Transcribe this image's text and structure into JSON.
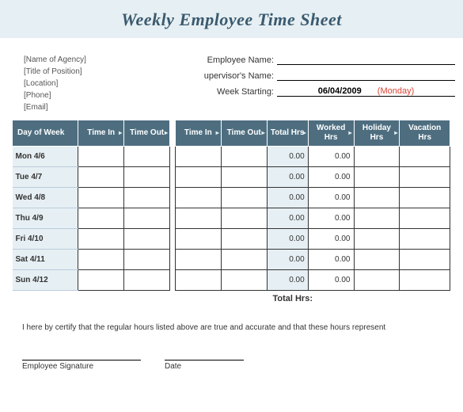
{
  "title": "Weekly Employee Time Sheet",
  "agency": {
    "name": "[Name of Agency]",
    "title_of_position": "[Title of Position]",
    "location": "[Location]",
    "phone": "[Phone]",
    "email": "[Email]"
  },
  "fields": {
    "employee_name_label": "Employee Name:",
    "employee_name_value": "",
    "supervisor_name_label": "upervisor's Name:",
    "supervisor_name_value": "",
    "week_starting_label": "Week Starting:",
    "week_starting_value": "06/04/2009",
    "week_starting_day": "(Monday)"
  },
  "headers": {
    "day": "Day of Week",
    "time_in": "Time In",
    "time_out": "Time Out",
    "total_hrs": "Total Hrs",
    "worked_hrs": "Worked Hrs",
    "holiday_hrs": "Holiday Hrs",
    "vacation_hrs": "Vacation Hrs"
  },
  "rows": [
    {
      "day": "Mon 4/6",
      "in1": "",
      "out1": "",
      "in2": "",
      "out2": "",
      "total": "0.00",
      "worked": "0.00",
      "holiday": "",
      "vacation": ""
    },
    {
      "day": "Tue 4/7",
      "in1": "",
      "out1": "",
      "in2": "",
      "out2": "",
      "total": "0.00",
      "worked": "0.00",
      "holiday": "",
      "vacation": ""
    },
    {
      "day": "Wed 4/8",
      "in1": "",
      "out1": "",
      "in2": "",
      "out2": "",
      "total": "0.00",
      "worked": "0.00",
      "holiday": "",
      "vacation": ""
    },
    {
      "day": "Thu 4/9",
      "in1": "",
      "out1": "",
      "in2": "",
      "out2": "",
      "total": "0.00",
      "worked": "0.00",
      "holiday": "",
      "vacation": ""
    },
    {
      "day": "Fri 4/10",
      "in1": "",
      "out1": "",
      "in2": "",
      "out2": "",
      "total": "0.00",
      "worked": "0.00",
      "holiday": "",
      "vacation": ""
    },
    {
      "day": "Sat 4/11",
      "in1": "",
      "out1": "",
      "in2": "",
      "out2": "",
      "total": "0.00",
      "worked": "0.00",
      "holiday": "",
      "vacation": ""
    },
    {
      "day": "Sun 4/12",
      "in1": "",
      "out1": "",
      "in2": "",
      "out2": "",
      "total": "0.00",
      "worked": "0.00",
      "holiday": "",
      "vacation": ""
    }
  ],
  "totals_label": "Total Hrs:",
  "certification": "I here by certify that the regular hours listed above are true and accurate and that these hours represent",
  "signature": {
    "employee_label": "Employee Signature",
    "date_label": "Date"
  }
}
